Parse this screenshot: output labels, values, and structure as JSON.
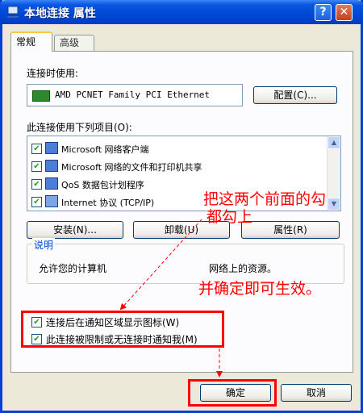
{
  "window": {
    "title": "本地连接  属性",
    "help_label": "?",
    "close_label": "✕"
  },
  "tabs": [
    {
      "label": "常规"
    },
    {
      "label": "高级"
    }
  ],
  "connect_using": {
    "label": "连接时使用:",
    "adapter": "AMD PCNET Family PCI Ethernet",
    "configure_button": "配置(C)..."
  },
  "items_section": {
    "label": "此连接使用下列项目(O):",
    "items": [
      {
        "label": "Microsoft 网络客户端",
        "checked": true,
        "icon": "network-client-icon"
      },
      {
        "label": "Microsoft 网络的文件和打印机共享",
        "checked": true,
        "icon": "file-printer-sharing-icon"
      },
      {
        "label": "QoS 数据包计划程序",
        "checked": true,
        "icon": "qos-scheduler-icon"
      },
      {
        "label": "Internet 协议 (TCP/IP)",
        "checked": true,
        "icon": "tcpip-protocol-icon"
      }
    ]
  },
  "buttons": {
    "install": "安装(N)...",
    "uninstall": "卸载(U)",
    "properties": "属性(R)"
  },
  "description": {
    "legend": "说明",
    "text_left": "允许您的计算机",
    "text_right": "网络上的资源。"
  },
  "options": [
    {
      "label": "连接后在通知区域显示图标(W)",
      "checked": true
    },
    {
      "label": "此连接被限制或无连接时通知我(M)",
      "checked": true
    }
  ],
  "footer": {
    "ok": "确定",
    "cancel": "取消"
  },
  "annotations": {
    "line1": "把这两个前面的勾",
    "line2": "都勾上",
    "line3": "并确定即可生效。",
    "color": "#ff0000"
  }
}
